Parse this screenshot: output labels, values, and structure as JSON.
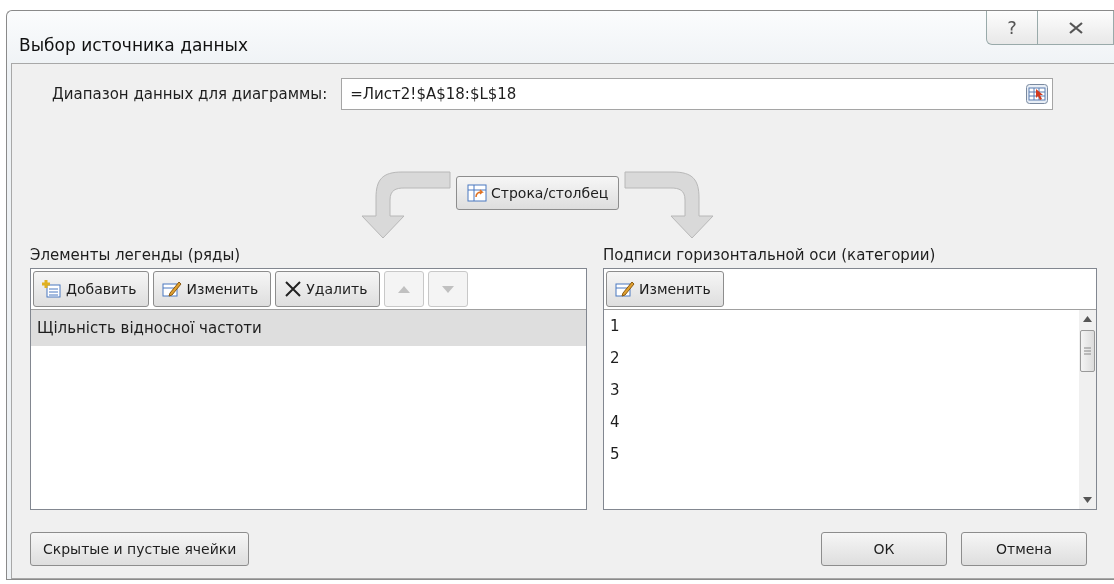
{
  "window": {
    "title": "Выбор источника данных",
    "controls": [
      {
        "kind": "help",
        "label": "?"
      },
      {
        "kind": "close"
      }
    ]
  },
  "range": {
    "label": "Диапазон данных для диаграммы:",
    "value": "=Лист2!$A$18:$L$18"
  },
  "switch_button": {
    "label": "Строка/столбец"
  },
  "legend": {
    "label": "Элементы легенды (ряды)",
    "buttons": [
      {
        "kind": "add",
        "label": "Добавить",
        "disabled": false
      },
      {
        "kind": "edit",
        "label": "Изменить",
        "disabled": false
      },
      {
        "kind": "delete",
        "label": "Удалить",
        "disabled": false
      },
      {
        "kind": "up",
        "disabled": true
      },
      {
        "kind": "down",
        "disabled": true
      }
    ],
    "items": [
      {
        "label": "Щільність відносної частоти",
        "selected": true
      }
    ]
  },
  "axis": {
    "label": "Подписи горизонтальной оси (категории)",
    "buttons": [
      {
        "kind": "edit",
        "label": "Изменить",
        "disabled": false
      }
    ],
    "items": [
      {
        "label": "1",
        "selected": false
      },
      {
        "label": "2",
        "selected": false
      },
      {
        "label": "3",
        "selected": false
      },
      {
        "label": "4",
        "selected": false
      },
      {
        "label": "5",
        "selected": false
      }
    ]
  },
  "footer": {
    "left_button": "Скрытые и пустые ячейки",
    "buttons": [
      "ОК",
      "Отмена"
    ]
  }
}
